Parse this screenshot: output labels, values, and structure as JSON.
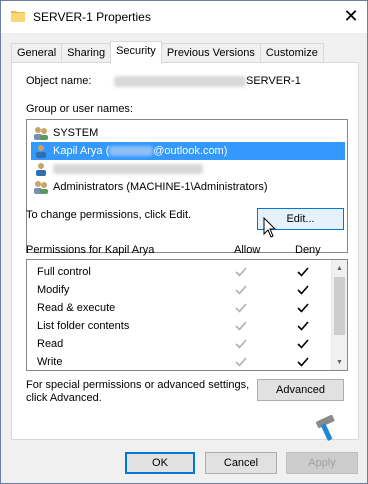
{
  "window": {
    "title": "SERVER-1 Properties",
    "close_icon": "close-icon"
  },
  "tabs": [
    {
      "label": "General",
      "active": false
    },
    {
      "label": "Sharing",
      "active": false
    },
    {
      "label": "Security",
      "active": true
    },
    {
      "label": "Previous Versions",
      "active": false
    },
    {
      "label": "Customize",
      "active": false
    }
  ],
  "security": {
    "object_name_label": "Object name:",
    "object_name_value": "SERVER-1",
    "groups_label": "Group or user names:",
    "users": [
      {
        "name": "SYSTEM",
        "icon": "group-icon",
        "selected": false
      },
      {
        "name_prefix": "Kapil Arya (",
        "name_suffix": "@outlook.com)",
        "icon": "user-icon",
        "selected": true
      },
      {
        "name": "",
        "icon": "user-icon",
        "selected": false
      },
      {
        "name": "Administrators (MACHINE-1\\Administrators)",
        "icon": "group-icon",
        "selected": false
      }
    ],
    "change_text": "To change permissions, click Edit.",
    "edit_button": "Edit...",
    "permissions_for": "Permissions for Kapil Arya",
    "allow_header": "Allow",
    "deny_header": "Deny",
    "permissions": [
      {
        "name": "Full control",
        "allow": true,
        "deny": true
      },
      {
        "name": "Modify",
        "allow": true,
        "deny": true
      },
      {
        "name": "Read & execute",
        "allow": true,
        "deny": true
      },
      {
        "name": "List folder contents",
        "allow": true,
        "deny": true
      },
      {
        "name": "Read",
        "allow": true,
        "deny": true
      },
      {
        "name": "Write",
        "allow": true,
        "deny": true
      }
    ],
    "advanced_text_1": "For special permissions or advanced settings,",
    "advanced_text_2": "click Advanced.",
    "advanced_button": "Advanced"
  },
  "footer": {
    "ok": "OK",
    "cancel": "Cancel",
    "apply": "Apply"
  },
  "colors": {
    "selection": "#3399ff",
    "focus_border": "#0078d7"
  }
}
